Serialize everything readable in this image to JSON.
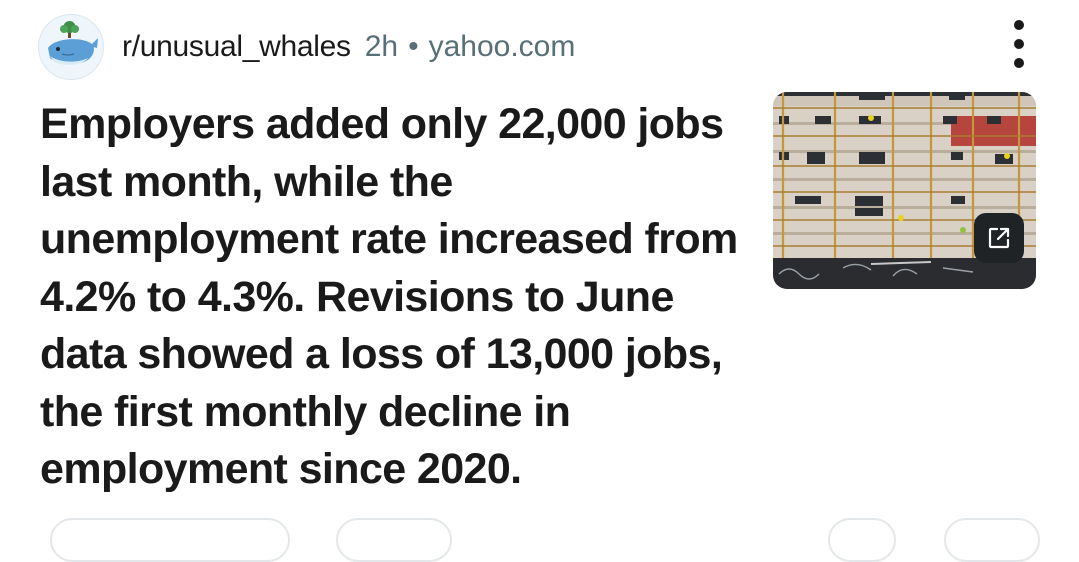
{
  "post": {
    "subreddit": "r/unusual_whales",
    "age": "2h",
    "separator": "•",
    "domain": "yahoo.com",
    "title": "Employers added only 22,000 jobs last month, while the unemployment rate increased from 4.2% to 4.3%. Revisions to June data showed a loss of 13,000 jobs, the first monthly decline in employment since 2020."
  },
  "icons": {
    "avatar": "whale-avatar-icon",
    "more": "more-options-icon",
    "external_link": "external-link-icon"
  },
  "colors": {
    "text": "#1a1a1b",
    "meta_text": "#576f76",
    "pill_border": "#e4e7e9"
  }
}
